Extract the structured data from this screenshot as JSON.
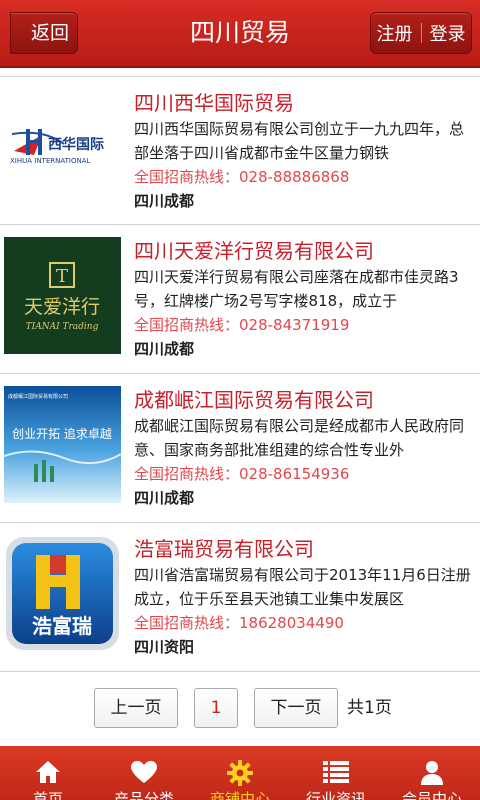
{
  "header": {
    "back_label": "返回",
    "title": "四川贸易",
    "register_label": "注册",
    "login_label": "登录"
  },
  "companies": [
    {
      "name": "四川西华国际贸易",
      "desc": "四川西华国际贸易有限公司创立于一九九四年，总部坐落于四川省成都市金牛区量力钢铁",
      "hotline": "全国招商热线：028-88886868",
      "location": "四川成都",
      "logo": {
        "text_cn": "西华国际",
        "text_en": "XIHUA INTERNATIONAL"
      }
    },
    {
      "name": "四川天爱洋行贸易有限公司",
      "desc": "四川天爱洋行贸易有限公司座落在成都市佳灵路3号，红牌楼广场2号写字楼818，成立于",
      "hotline": "全国招商热线：028-84371919",
      "location": "四川成都",
      "logo": {
        "mark": "T",
        "text_cn": "天爱洋行",
        "text_en": "TIANAI Trading"
      }
    },
    {
      "name": "成都岷江国际贸易有限公司",
      "desc": "成都岷江国际贸易有限公司是经成都市人民政府同意、国家商务部批准组建的综合性专业外",
      "hotline": "全国招商热线：028-86154936",
      "location": "四川成都",
      "logo": {
        "text_top": "成都岷江国际贸易有限公司",
        "text_mid": "创业开拓 追求卓越"
      }
    },
    {
      "name": "浩富瑞贸易有限公司",
      "desc": "四川省浩富瑞贸易有限公司于2013年11月6日注册成立，位于乐至县天池镇工业集中发展区",
      "hotline": "全国招商热线：18628034490",
      "location": "四川资阳",
      "logo": {
        "mark": "H",
        "text_cn": "浩富瑞"
      }
    }
  ],
  "pager": {
    "prev_label": "上一页",
    "current_page": "1",
    "next_label": "下一页",
    "total_label": "共1页"
  },
  "bottom_nav": [
    {
      "label": "首页",
      "icon": "home-icon"
    },
    {
      "label": "产品分类",
      "icon": "heart-icon"
    },
    {
      "label": "商铺中心",
      "icon": "gear-icon",
      "active": true
    },
    {
      "label": "行业资讯",
      "icon": "list-icon"
    },
    {
      "label": "会员中心",
      "icon": "user-icon"
    }
  ],
  "colors": {
    "brand_red": "#c8202a",
    "active_nav": "#ffd21e"
  }
}
